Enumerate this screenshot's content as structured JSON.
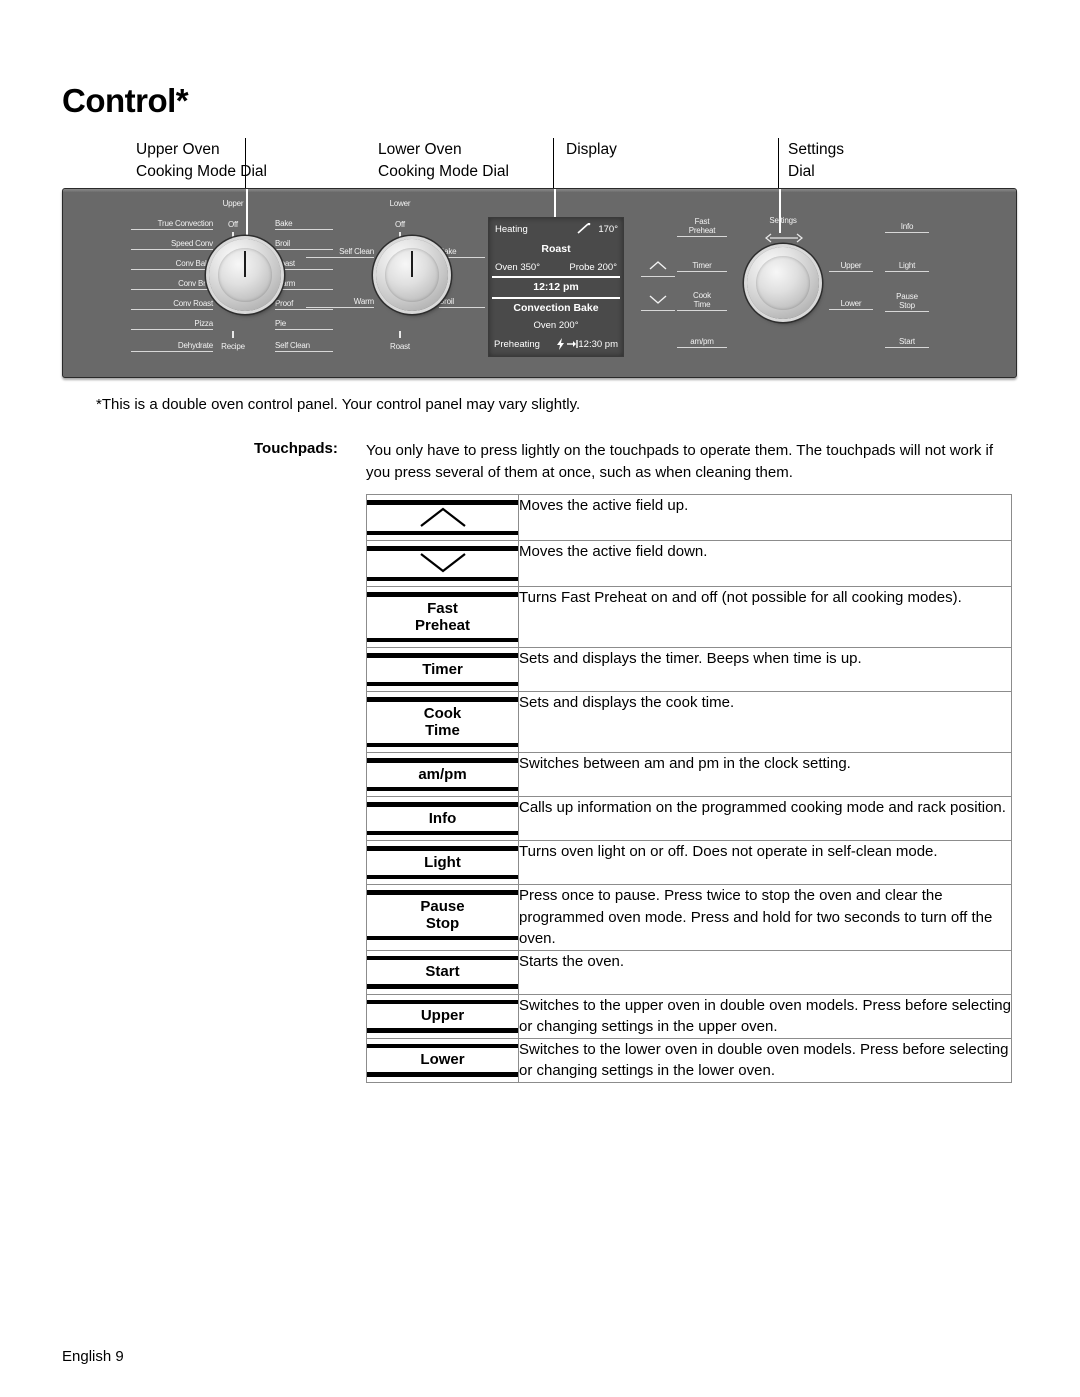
{
  "page": {
    "title": "Control*",
    "footer": "English 9",
    "note": "*This is a double oven control panel. Your control panel may vary slightly.",
    "touchpads_label": "Touchpads:",
    "touchpads_text": "You only have to press lightly on the touchpads to operate them. The touchpads will not work if you press several of them at once, such as when cleaning them."
  },
  "callouts": [
    {
      "text": "Upper Oven\nCooking Mode Dial"
    },
    {
      "text": "Lower Oven\nCooking Mode Dial"
    },
    {
      "text": "Display"
    },
    {
      "text": "Settings\nDial"
    }
  ],
  "panel": {
    "background_color": "#696969",
    "upper_dial": {
      "name": "Upper",
      "top_label": "Off",
      "left_labels": [
        "True Convection",
        "Speed Conv",
        "Conv Bake",
        "Conv Broil",
        "Conv Roast",
        "Pizza",
        "Dehydrate"
      ],
      "bottom_label": "Recipe",
      "right_labels": [
        "Bake",
        "Broil",
        "Roast",
        "Warm",
        "Proof",
        "Pie",
        "Self Clean"
      ]
    },
    "lower_dial": {
      "name": "Lower",
      "top_label": "Off",
      "left_labels": [
        "Self Clean",
        "Warm"
      ],
      "bottom_label": "Roast",
      "right_labels": [
        "Bake",
        "Broil"
      ]
    },
    "settings_dial": {
      "name": "Settings",
      "arrow_icon": "left-right-arrow-icon"
    },
    "display": {
      "status": "Heating",
      "probe_icon": "probe-icon",
      "probe_temp": "170°",
      "mode": "Roast",
      "oven_temp": "Oven 350°",
      "probe_setpoint": "Probe 200°",
      "clock": "12:12 pm",
      "mode2": "Convection Bake",
      "oven_temp2": "Oven 200°",
      "status2": "Preheating",
      "bolt_icon": "bolt-icon",
      "end_icon": "end-arrow-icon",
      "end_time": "12:30 pm"
    },
    "keypads_left": [
      "Fast\nPreheat",
      "Timer",
      "Cook\nTime",
      "am/pm"
    ],
    "keypads_arrows": [
      "chevron-up-icon",
      "chevron-down-icon"
    ],
    "keypads_mid": [
      "Upper",
      "Lower"
    ],
    "keypads_right": [
      "Info",
      "Light",
      "Pause\nStop",
      "Start"
    ]
  },
  "table": {
    "rows": [
      {
        "icon": "chevron-up-icon",
        "label": "",
        "desc": "Moves the active field up."
      },
      {
        "icon": "chevron-down-icon",
        "label": "",
        "desc": "Moves the active field down."
      },
      {
        "icon": "",
        "label": "Fast\nPreheat",
        "desc": "Turns Fast Preheat on and off (not possible for all cooking modes)."
      },
      {
        "icon": "",
        "label": "Timer",
        "desc": "Sets and displays the timer. Beeps when time is up."
      },
      {
        "icon": "",
        "label": "Cook\nTime",
        "desc": "Sets and displays the cook time."
      },
      {
        "icon": "",
        "label": "am/pm",
        "desc": "Switches between am and pm in the clock setting."
      },
      {
        "icon": "",
        "label": "Info",
        "desc": "Calls up information on the programmed cooking mode and rack position."
      },
      {
        "icon": "",
        "label": "Light",
        "desc": "Turns oven light on or off. Does not operate in self-clean mode."
      },
      {
        "icon": "",
        "label": "Pause\nStop",
        "desc": "Press once to pause. Press twice to stop the oven and clear the programmed oven mode. Press and hold for two seconds to turn off the oven."
      },
      {
        "icon": "",
        "label": "Start",
        "desc": "Starts the oven."
      },
      {
        "icon": "",
        "label": "Upper",
        "desc": "Switches to the upper oven in double oven models. Press before selecting or changing settings in the upper oven."
      },
      {
        "icon": "",
        "label": "Lower",
        "desc": "Switches to the lower oven in double oven models. Press before selecting or changing settings in the lower oven."
      }
    ]
  }
}
